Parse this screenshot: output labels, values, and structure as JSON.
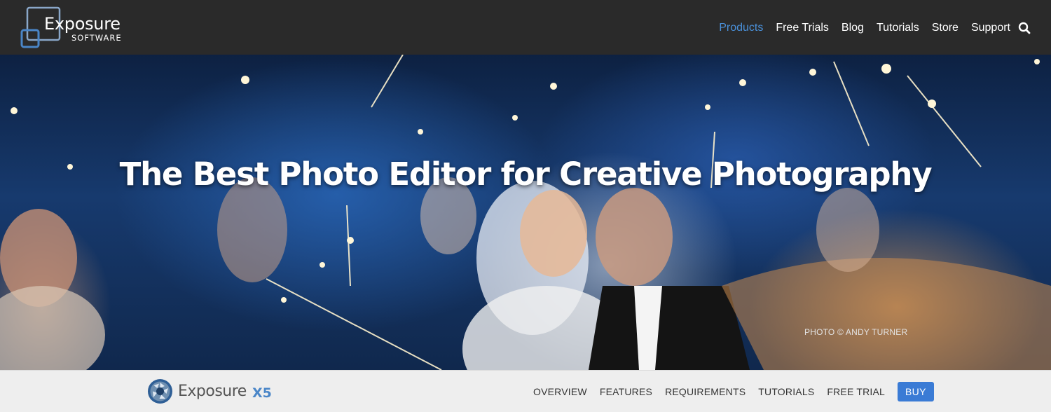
{
  "header": {
    "logo": {
      "wordmark": "Exposure",
      "subtitle": "SOFTWARE"
    },
    "nav": [
      {
        "label": "Products",
        "active": true
      },
      {
        "label": "Free Trials",
        "active": false
      },
      {
        "label": "Blog",
        "active": false
      },
      {
        "label": "Tutorials",
        "active": false
      },
      {
        "label": "Store",
        "active": false
      },
      {
        "label": "Support",
        "active": false
      }
    ],
    "search_icon": "search-icon"
  },
  "hero": {
    "title": "The Best Photo Editor for Creative Photography",
    "photo_credit": "PHOTO © ANDY TURNER"
  },
  "product_nav": {
    "product_name": "Exposure",
    "version": "X5",
    "links": [
      "OVERVIEW",
      "FEATURES",
      "REQUIREMENTS",
      "TUTORIALS",
      "FREE TRIAL"
    ],
    "buy_label": "BUY"
  },
  "colors": {
    "header_bg": "#2a2a2a",
    "nav_active": "#4a90d9",
    "subnav_bg": "#eeeeee",
    "buy_button": "#3a7bd5",
    "version_accent": "#4a86c8"
  }
}
